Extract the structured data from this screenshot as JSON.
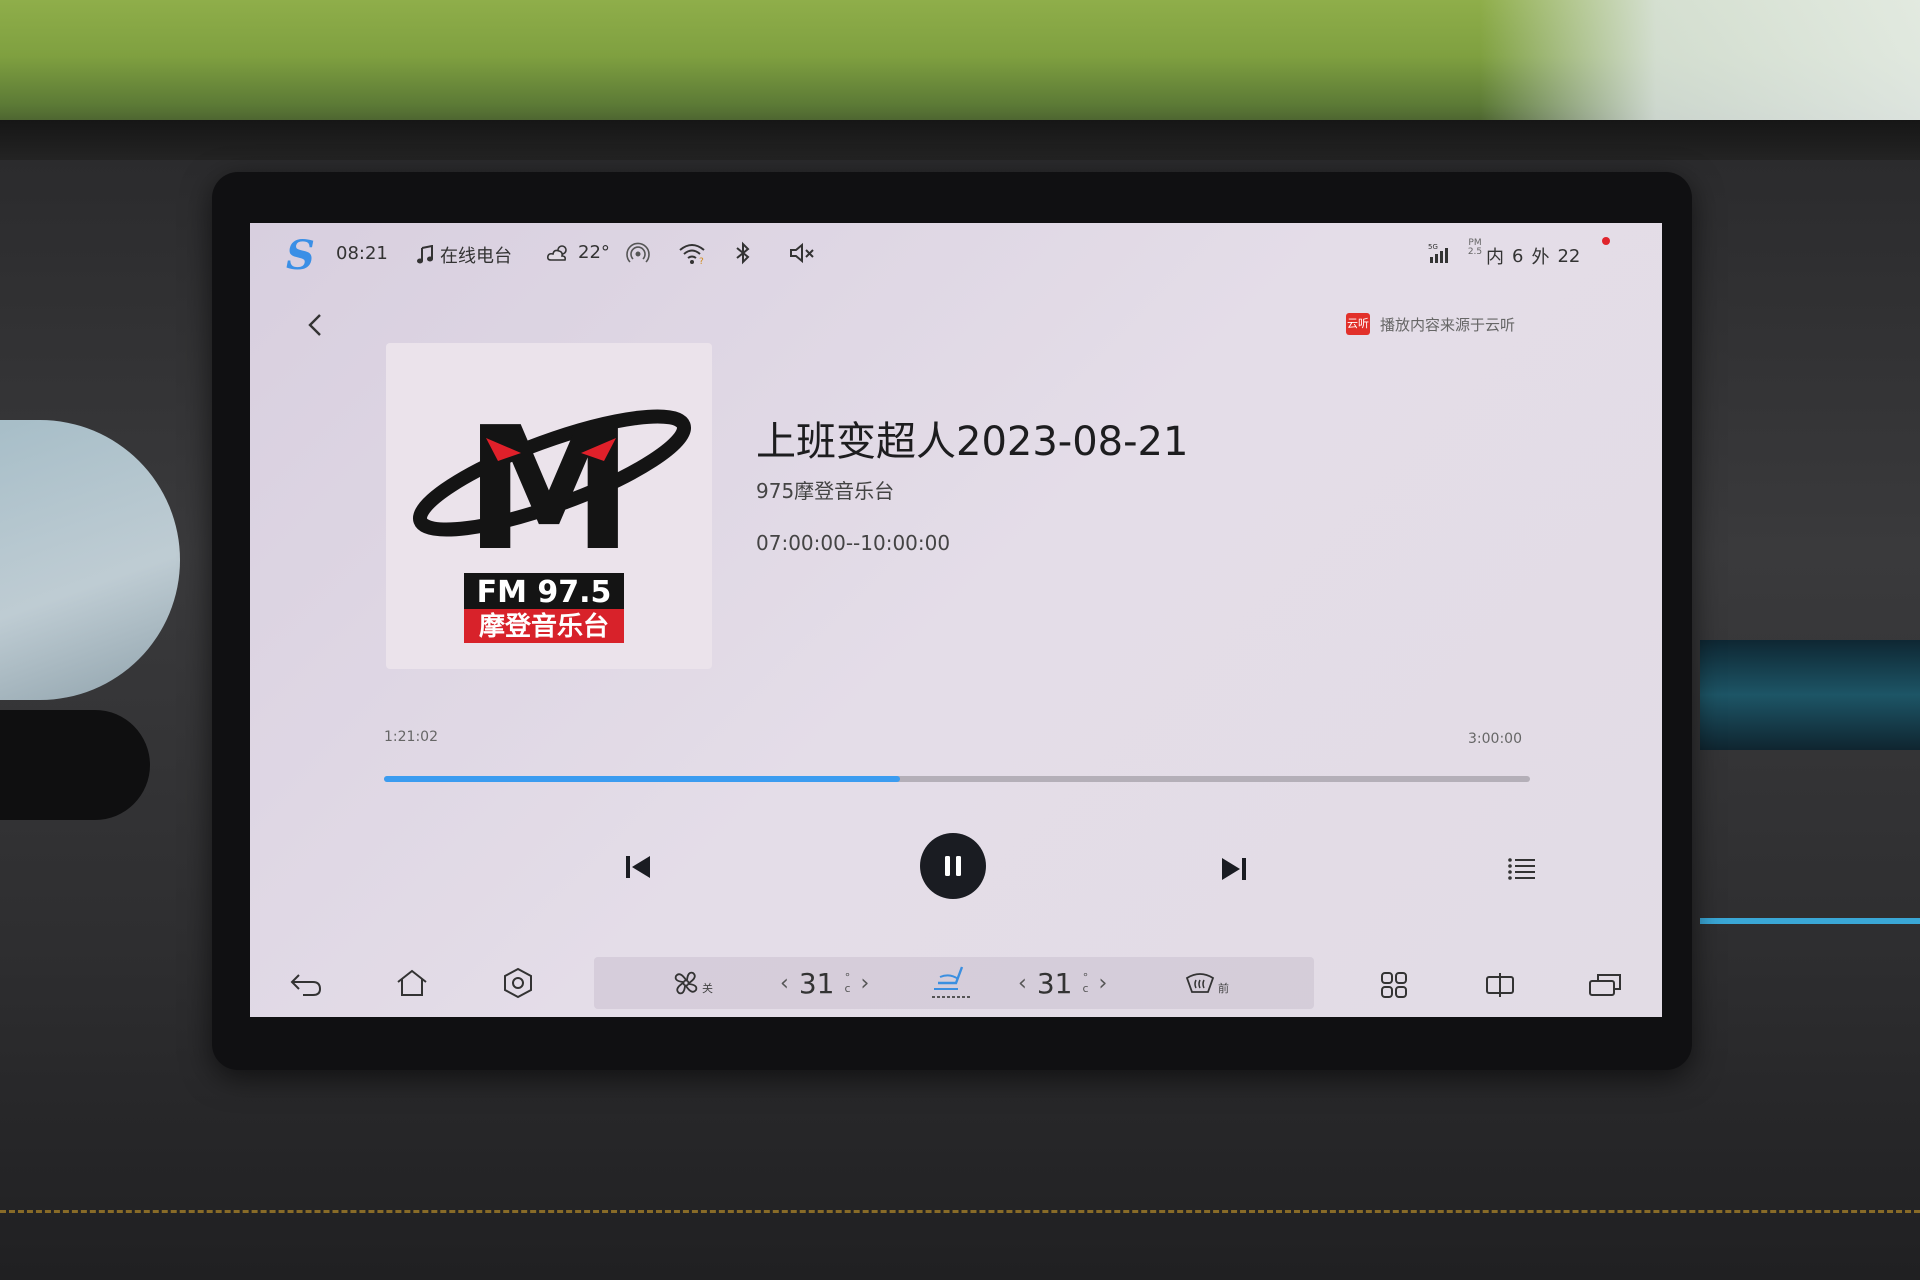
{
  "status_bar": {
    "time": "08:21",
    "source_label": "在线电台",
    "weather_temp": "22°",
    "network": "5G",
    "pm_label": "PM 2.5",
    "air_inside_label": "内",
    "air_inside_value": "6",
    "air_outside_label": "外",
    "air_outside_value": "22",
    "icons": [
      "s-logo-icon",
      "music-note-icon",
      "cloud-sun-icon",
      "radio-signal-icon",
      "wifi-icon",
      "bluetooth-icon",
      "mute-icon",
      "cellular-signal-icon"
    ]
  },
  "header": {
    "back_icon": "chevron-left-icon",
    "source_badge": "云听",
    "source_note": "播放内容来源于云听"
  },
  "album_art": {
    "logo_letter": "M",
    "frequency": "FM 97.5",
    "station_name": "摩登音乐台"
  },
  "track": {
    "title": "上班变超人2023-08-21",
    "station": "975摩登音乐台",
    "schedule": "07:00:00--10:00:00"
  },
  "progress": {
    "elapsed": "1:21:02",
    "duration": "3:00:00",
    "fraction": 0.45
  },
  "controls": {
    "prev_icon": "skip-previous-icon",
    "play_pause_icon": "pause-icon",
    "next_icon": "skip-next-icon",
    "playlist_icon": "playlist-icon"
  },
  "dock": {
    "back_icon": "return-icon",
    "home_icon": "home-icon",
    "settings_icon": "settings-hex-icon",
    "fan_state": "关",
    "driver_temp": "31",
    "passenger_temp": "31",
    "temp_unit_top": "°",
    "temp_unit_bottom": "c",
    "chevron_left": "‹",
    "chevron_right": "›",
    "defrost_label": "前",
    "apps_icon": "grid-apps-icon",
    "split_icon": "split-screen-icon",
    "multiwindow_icon": "multi-window-icon"
  },
  "colors": {
    "accent_blue": "#3b9cf0",
    "screen_bg": "#e2dce5",
    "play_button": "#1a1c22",
    "badge_red": "#e2302a"
  }
}
